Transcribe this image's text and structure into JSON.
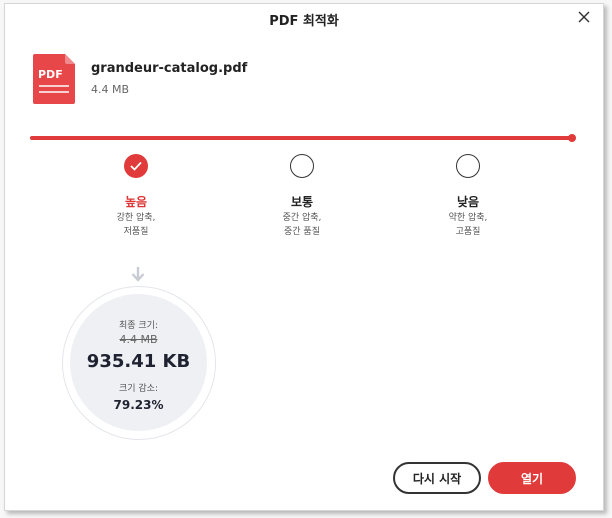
{
  "dialog": {
    "title": "PDF 최적화"
  },
  "file": {
    "icon_label": "PDF",
    "name": "grandeur-catalog.pdf",
    "size": "4.4 MB"
  },
  "compression": {
    "selected_index": 0,
    "levels": [
      {
        "title": "높음",
        "desc_line1": "강한 압축,",
        "desc_line2": "저품질",
        "selected": true
      },
      {
        "title": "보통",
        "desc_line1": "중간 압축,",
        "desc_line2": "중간 품질",
        "selected": false
      },
      {
        "title": "낮음",
        "desc_line1": "약한 압축,",
        "desc_line2": "고품질",
        "selected": false
      }
    ]
  },
  "result": {
    "final_size_label": "최종 크기:",
    "original_size": "4.4 MB",
    "new_size": "935.41 KB",
    "reduction_label": "크기 감소:",
    "reduction_percent": "79.23%"
  },
  "buttons": {
    "restart": "다시 시작",
    "open": "열기"
  },
  "colors": {
    "accent": "#e03a3a",
    "text_dark": "#1f2230",
    "circle_bg": "#eef0f4"
  }
}
